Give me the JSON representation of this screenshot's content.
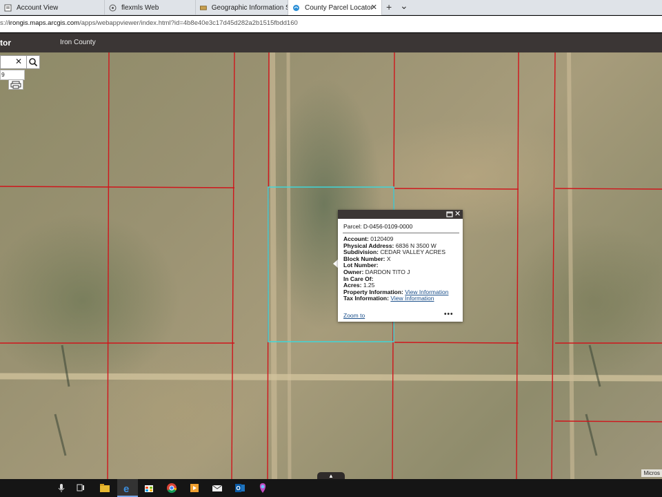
{
  "browser": {
    "tabs": [
      {
        "label": "Account View",
        "icon": "document-icon",
        "active": false
      },
      {
        "label": "flexmls Web",
        "icon": "globe-icon",
        "active": false
      },
      {
        "label": "Geographic Information Sys",
        "icon": "card-icon",
        "active": false
      },
      {
        "label": "County Parcel Locator",
        "icon": "arcgis-icon",
        "active": true
      }
    ],
    "close_glyph": "✕",
    "new_tab_glyph": "+",
    "menu_glyph": "⌄",
    "address": {
      "prefix": "s://",
      "host": "irongis.maps.arcgis.com",
      "path": "/apps/webappviewer/index.html?id=4b8e40e3c17d45d282a2b1515fbdd160"
    }
  },
  "app": {
    "title": "tor",
    "subtitle": "Iron County"
  },
  "search": {
    "clear_glyph": "✕",
    "suggestion": "9"
  },
  "popup": {
    "title": "Parcel: D-0456-0109-0000",
    "close_glyph": "✕",
    "fields": [
      {
        "label": "Account:",
        "value": "0120409"
      },
      {
        "label": "Physical Address:",
        "value": "6836 N 3500 W"
      },
      {
        "label": "Subdivision:",
        "value": "CEDAR VALLEY ACRES"
      },
      {
        "label": "Block Number:",
        "value": "X"
      },
      {
        "label": "Lot Number:",
        "value": ""
      },
      {
        "label": "Owner:",
        "value": "DARDON TITO J"
      },
      {
        "label": "In Care Of:",
        "value": ""
      },
      {
        "label": "Acres:",
        "value": "1.25"
      }
    ],
    "links": [
      {
        "label": "Property Information:",
        "link": "View Information"
      },
      {
        "label": "Tax Information:",
        "link": "View Information"
      }
    ],
    "zoom_label": "Zoom to",
    "more_glyph": "•••"
  },
  "map": {
    "attribution": "Micros",
    "collapse_glyph": "▲",
    "parcel_line_color": "#d0141b",
    "selected_parcel_color": "#3fd7d9"
  },
  "taskbar": {
    "icons": [
      "microphone-icon",
      "task-view-icon",
      "file-explorer-icon",
      "edge-icon",
      "store-icon",
      "chrome-icon",
      "media-icon",
      "mail-icon",
      "outlook-icon",
      "feedback-icon"
    ]
  }
}
